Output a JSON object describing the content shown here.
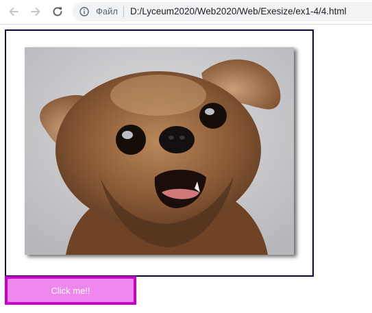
{
  "browser": {
    "scheme_label": "Файл",
    "url": "D:/Lyceum2020/Web2020/Web/Exesize/ex1-4/4.html"
  },
  "page": {
    "image_subject": "dog-photo",
    "button_label": "Click me!!",
    "colors": {
      "frame_border": "#0c0640",
      "button_fill": "#ee88ee",
      "button_border": "#c800c8",
      "button_text": "#ffffff"
    }
  }
}
